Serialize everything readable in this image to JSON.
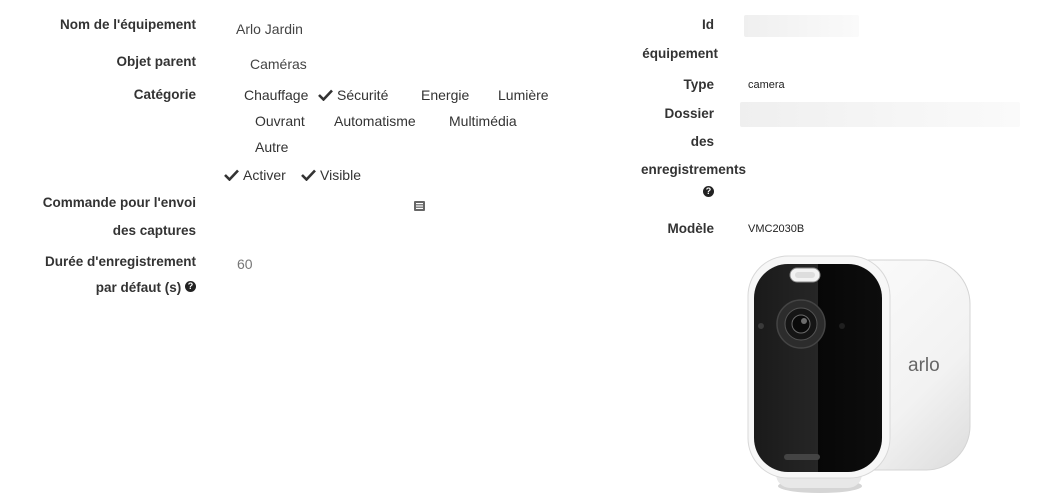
{
  "left": {
    "name_label": "Nom de l'équipement",
    "name_value": "Arlo Jardin",
    "parent_label": "Objet parent",
    "parent_value": "Caméras",
    "category_label": "Catégorie",
    "categories": [
      {
        "label": "Chauffage",
        "checked": false
      },
      {
        "label": "Sécurité",
        "checked": true
      },
      {
        "label": "Energie",
        "checked": false
      },
      {
        "label": "Lumière",
        "checked": false
      },
      {
        "label": "Ouvrant",
        "checked": false
      },
      {
        "label": "Automatisme",
        "checked": false
      },
      {
        "label": "Multimédia",
        "checked": false
      },
      {
        "label": "Autre",
        "checked": false
      }
    ],
    "activate_label": "Activer",
    "activate_checked": true,
    "visible_label": "Visible",
    "visible_checked": true,
    "command_label_1": "Commande pour l'envoi",
    "command_label_2": "des captures",
    "duration_label_1": "Durée d'enregistrement",
    "duration_label_2": "par défaut (s)",
    "duration_value": "60"
  },
  "right": {
    "id_label_1": "Id",
    "id_label_2": "équipement",
    "type_label": "Type",
    "type_value": "camera",
    "folder_label_1": "Dossier",
    "folder_label_2": "des",
    "folder_label_3": "enregistrements",
    "model_label": "Modèle",
    "model_value": "VMC2030B",
    "camera_brand": "arlo"
  },
  "icons": {
    "help": "question-circle-icon",
    "check": "check-icon",
    "list": "list-icon"
  }
}
